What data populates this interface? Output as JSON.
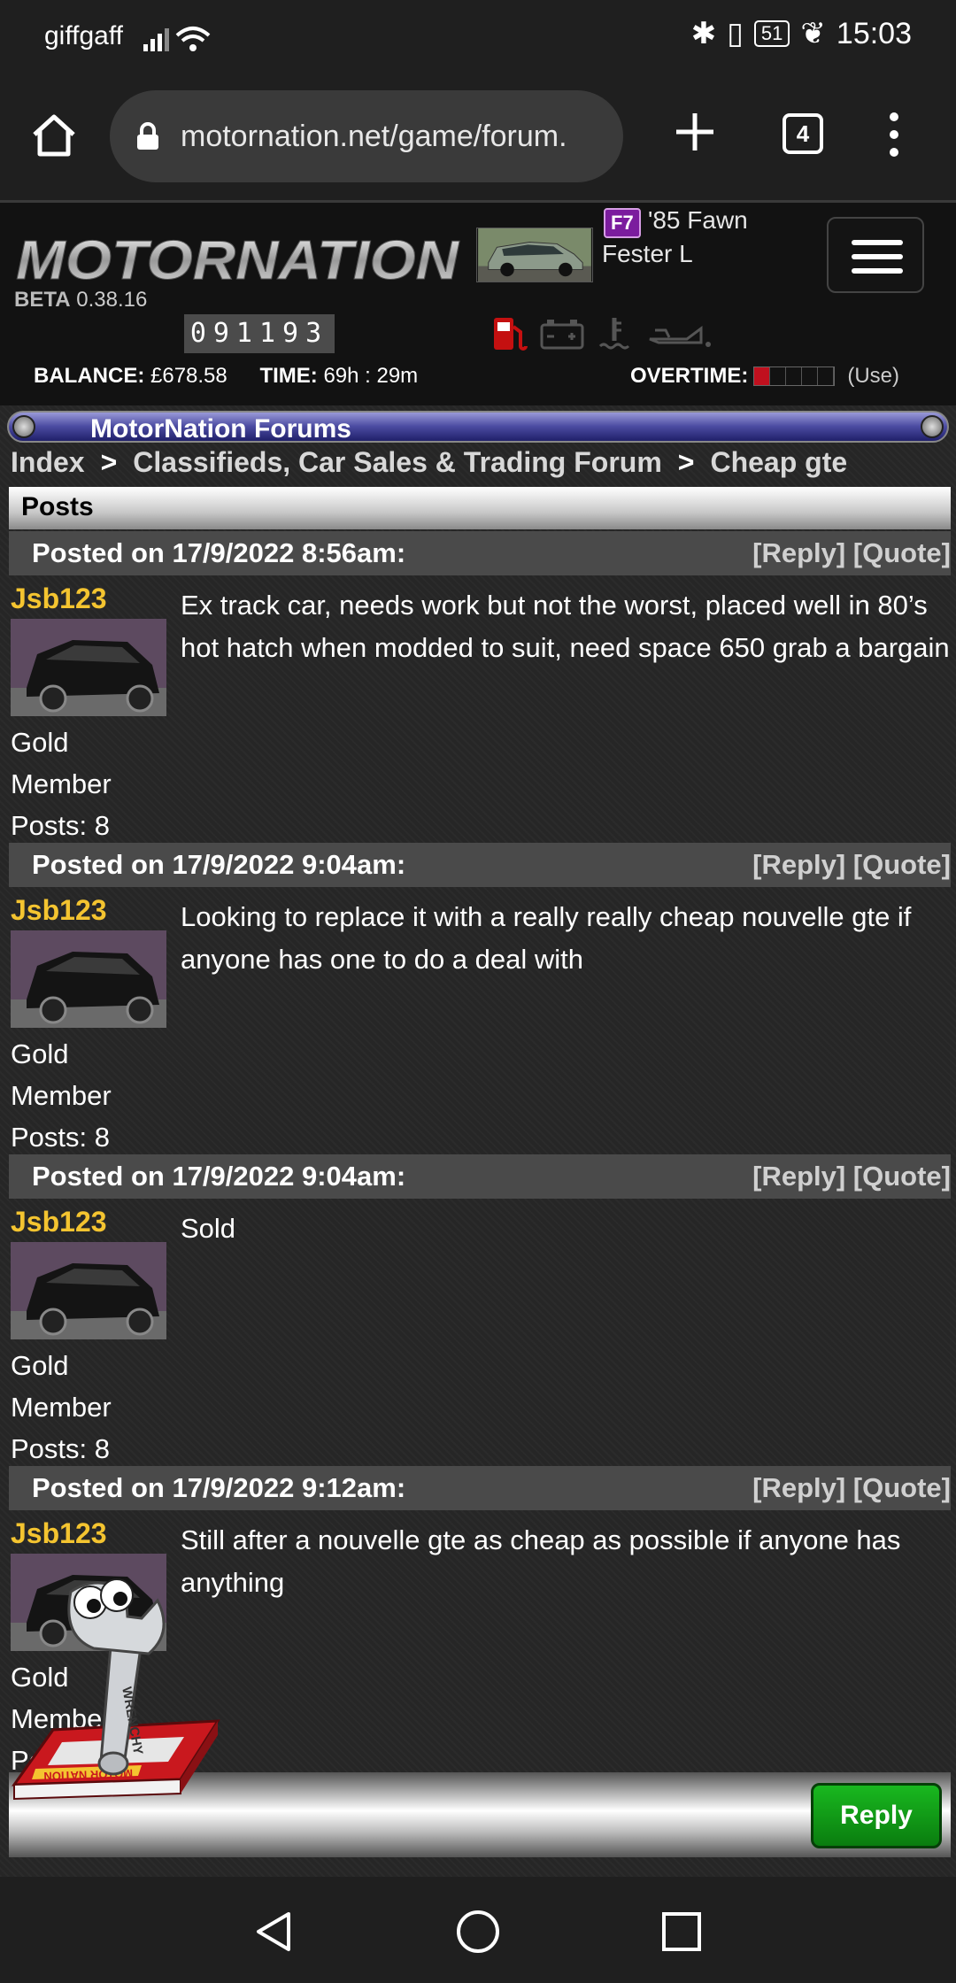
{
  "status_bar": {
    "carrier": "giffgaff",
    "battery": "51",
    "time": "15:03"
  },
  "browser": {
    "url": "motornation.net/game/forum.",
    "tab_count": "4"
  },
  "game_header": {
    "logo_text": "MOTORNATION",
    "version_label": "BETA",
    "version": "0.38.16",
    "odometer": "091193",
    "car_badge": "F7",
    "car_name": "'85 Fawn",
    "car_owner": "Fester L",
    "balance_label": "BALANCE:",
    "balance": "£678.58",
    "time_label": "TIME:",
    "time": "69h : 29m",
    "overtime_label": "OVERTIME:",
    "overtime_use": "(Use)",
    "overtime_filled": 1,
    "overtime_total": 5
  },
  "forum": {
    "title": "MotorNation Forums",
    "breadcrumb": [
      "Index",
      "Classifieds, Car Sales & Trading Forum",
      "Cheap gte"
    ],
    "breadcrumb_sep": ">",
    "posts_heading": "Posts",
    "posts": [
      {
        "posted": "Posted on 17/9/2022 8:56am:",
        "actions": "[Reply] [Quote]",
        "author": "Jsb123",
        "rank_line1": "Gold",
        "rank_line2": "Member",
        "post_count": "Posts: 8",
        "text": "Ex track car, needs work but not the worst, placed well in 80’s hot hatch when modded to suit, need space 650 grab a bargain"
      },
      {
        "posted": "Posted on 17/9/2022 9:04am:",
        "actions": "[Reply] [Quote]",
        "author": "Jsb123",
        "rank_line1": "Gold",
        "rank_line2": "Member",
        "post_count": "Posts: 8",
        "text": "Looking to replace it with a really really cheap nouvelle gte if anyone has one to do a deal with"
      },
      {
        "posted": "Posted on 17/9/2022 9:04am:",
        "actions": "[Reply] [Quote]",
        "author": "Jsb123",
        "rank_line1": "Gold",
        "rank_line2": "Member",
        "post_count": "Posts: 8",
        "text": "Sold"
      },
      {
        "posted": "Posted on 17/9/2022 9:12am:",
        "actions": "[Reply] [Quote]",
        "author": "Jsb123",
        "rank_line1": "Gold",
        "rank_line2": "Member",
        "post_count": "Posts: 8",
        "text": "Still after a nouvelle gte as cheap as possible if anyone has anything"
      }
    ],
    "reply_button": "Reply"
  },
  "mascot": {
    "label": "WRENCHY",
    "book_text": "MOTOR NATION"
  },
  "colors": {
    "username": "#f4c430",
    "reply_green": "#0f9a15",
    "post_header_bg": "#4a4a4a"
  }
}
